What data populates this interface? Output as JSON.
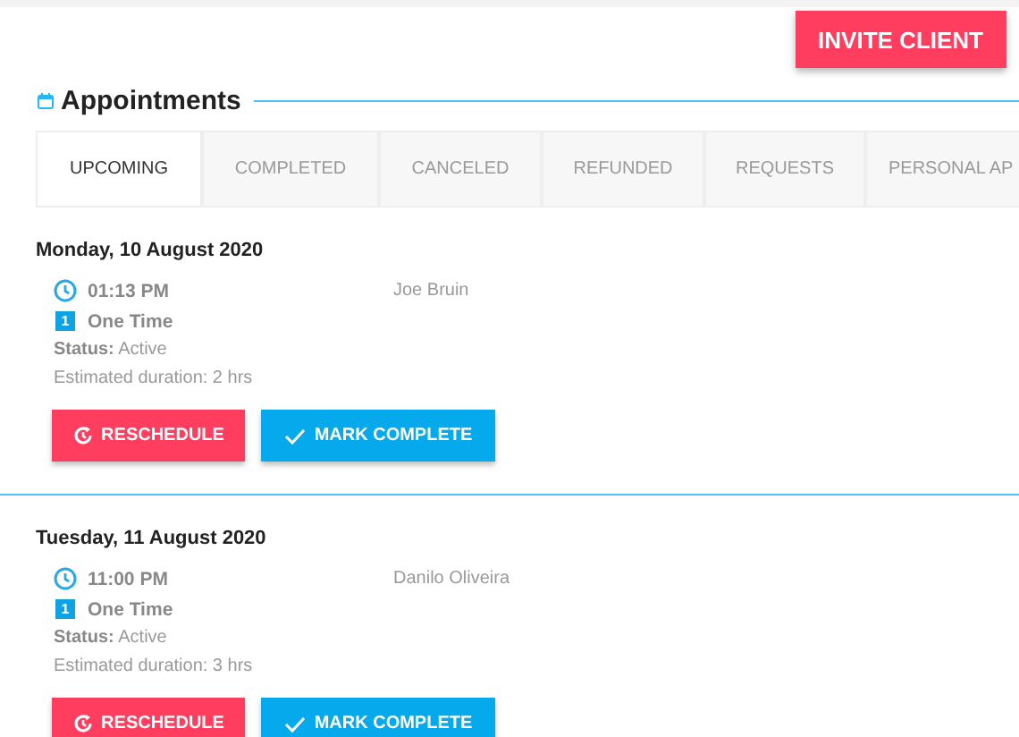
{
  "invite_button": "INVITE CLIENT",
  "section": {
    "title": "Appointments"
  },
  "tabs": [
    {
      "label": "UPCOMING",
      "selected": true
    },
    {
      "label": "COMPLETED",
      "selected": false
    },
    {
      "label": "CANCELED",
      "selected": false
    },
    {
      "label": "REFUNDED",
      "selected": false
    },
    {
      "label": "REQUESTS",
      "selected": false
    },
    {
      "label": "PERSONAL AP",
      "selected": false
    }
  ],
  "appointments": [
    {
      "date": "Monday, 10 August 2020",
      "time": "01:13 PM",
      "client": "Joe Bruin",
      "badge": "1",
      "type": "One Time",
      "status": "**Status:** Active",
      "duration": "Estimated duration: 2 hrs",
      "actions": [
        "RESCHEDULE",
        "MARK COMPLETE"
      ]
    },
    {
      "date": "Tuesday, 11 August 2020",
      "time": "11:00 PM",
      "client": "Danilo Oliveira",
      "badge": "1",
      "type": "One Time",
      "status": "**Status:** Active",
      "duration": "Estimated duration: 3 hrs",
      "actions": [
        "RESCHEDULE",
        "MARK COMPLETE"
      ]
    }
  ]
}
